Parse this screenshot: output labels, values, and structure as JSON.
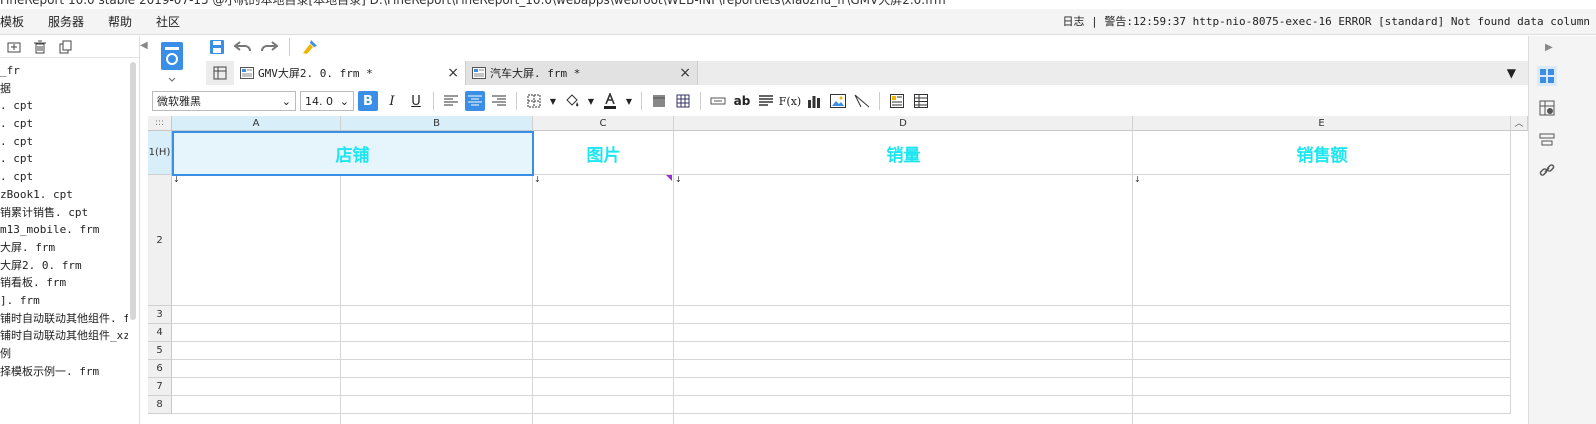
{
  "window": {
    "title": "FineReport 10.0 stable 2019-07-15 @小帆的本地目录[本地目录]    D:\\FineReport\\FineReport_10.0\\webapps\\webroot\\WEB-INF\\reportlets\\xiaozhu_fr\\GMV大屏2.0.frm"
  },
  "menubar": {
    "items": [
      "模板",
      "服务器",
      "帮助",
      "社区"
    ],
    "log_label": "日志",
    "separator": "|",
    "warning_text": "警告:12:59:37 http-nio-8075-exec-16 ERROR [standard] Not found data column"
  },
  "left_panel": {
    "icons": [
      "new-folder-icon",
      "delete-icon",
      "copy-icon"
    ],
    "items": [
      "_fr",
      "据",
      ". cpt",
      ". cpt",
      ". cpt",
      ". cpt",
      ". cpt",
      "zBook1. cpt",
      "销累计销售. cpt",
      "m13_mobile. frm",
      "大屏. frm",
      "大屏2. 0. frm",
      "销看板. frm",
      "]. frm",
      "铺时自动联动其他组件. fr",
      "铺时自动联动其他组件_xz",
      "例",
      "择模板示例一. frm"
    ]
  },
  "toolbar": {
    "icons": [
      "save-icon",
      "undo-icon",
      "redo-icon",
      "format-brush-icon"
    ]
  },
  "tabs": [
    {
      "label": "GMV大屏2. 0. frm *",
      "close": "×",
      "active": true
    },
    {
      "label": "汽车大屏. frm *",
      "close": "×",
      "active": false
    }
  ],
  "format_bar": {
    "font_name": "微软雅黑",
    "font_size": "14. 0",
    "bold": "B",
    "italic": "I",
    "underline": "U",
    "text_ab": "ab",
    "formula": "F(x)"
  },
  "grid": {
    "corner": ":::",
    "columns": [
      "A",
      "B",
      "C",
      "D",
      "E"
    ],
    "rows": [
      "1(H)",
      "2",
      "3",
      "4",
      "5",
      "6",
      "7",
      "8"
    ],
    "header_cells": [
      {
        "col": "A-B",
        "text": "店铺"
      },
      {
        "col": "C",
        "text": "图片"
      },
      {
        "col": "D",
        "text": "销量"
      },
      {
        "col": "E",
        "text": "销售额"
      }
    ],
    "text_color": "#1ee6f0",
    "selection_color": "#3a8ee6"
  },
  "right_rail": {
    "icons": [
      "widget-panel-icon",
      "cell-attribute-icon",
      "component-icon",
      "link-icon"
    ]
  }
}
